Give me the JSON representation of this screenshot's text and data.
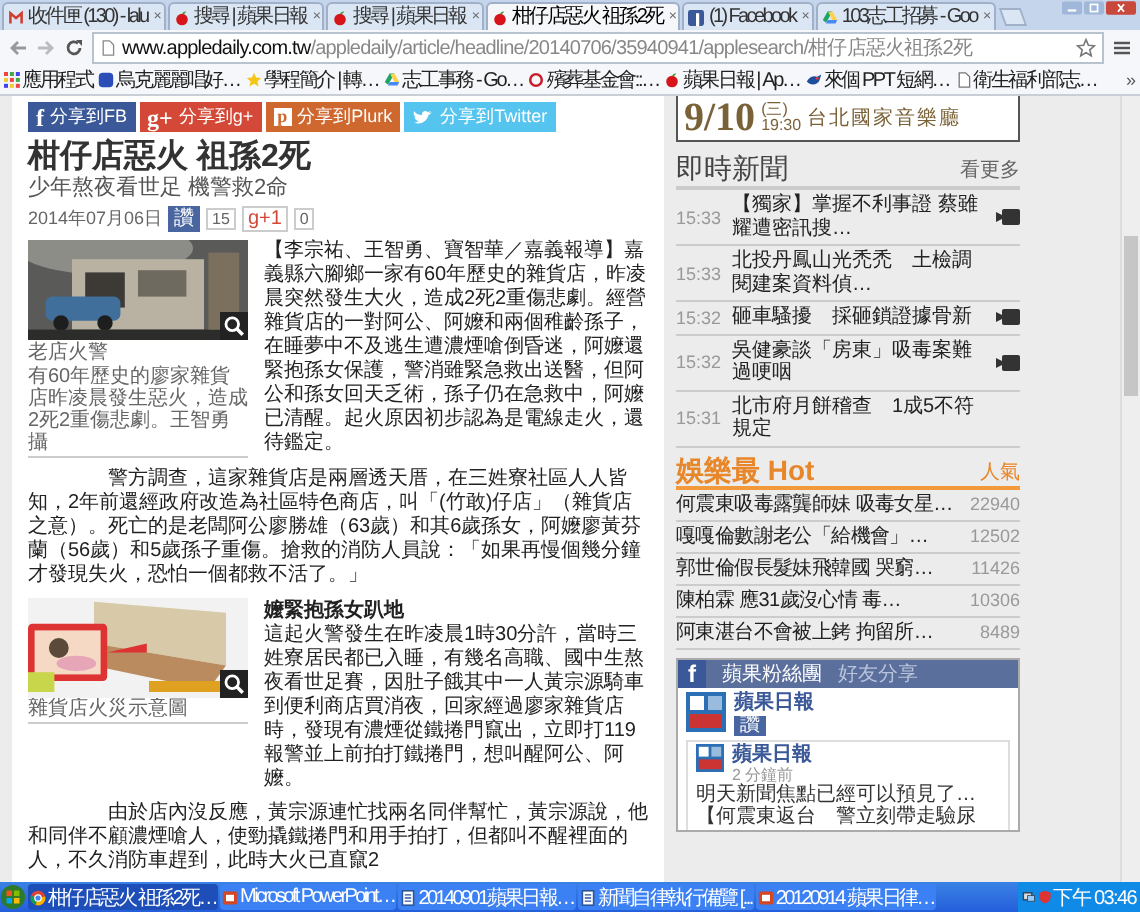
{
  "browser": {
    "tabs": [
      {
        "title": "收件匣 (130) - lalu",
        "close": "×",
        "selected": false
      },
      {
        "title": "搜尋 | 蘋果日報",
        "close": "×",
        "selected": false
      },
      {
        "title": "搜尋 | 蘋果日報",
        "close": "×",
        "selected": false
      },
      {
        "title": "柑仔店惡火 祖孫2死",
        "close": "×",
        "selected": true
      },
      {
        "title": "(1) Facebook",
        "close": "×",
        "selected": false
      },
      {
        "title": "103志工招募 - Goo",
        "close": "×",
        "selected": false
      }
    ],
    "url_host": "www.appledaily.com.tw",
    "url_path": "/appledaily/article/headline/20140706/35940941/applesearch/柑仔店惡火祖孫2死",
    "bookmarks": [
      "應用程式",
      "烏克麗麗唱好…",
      "學程簡介 | 轉…",
      "志工事務 - Go…",
      "殯葬基金會::…",
      "蘋果日報 | Ap…",
      "來個 PPT 短網…",
      "衛生福利部志…"
    ],
    "bookmarks_more": "»"
  },
  "article": {
    "share_buttons": [
      {
        "glyph": "f",
        "label": "分享到FB"
      },
      {
        "glyph": "g+",
        "label": "分享到g+"
      },
      {
        "glyph": "p",
        "label": "分享到Plurk"
      },
      {
        "label": "分享到Twitter"
      }
    ],
    "title": "柑仔店惡火 祖孫2死",
    "subtitle": "少年熬夜看世足 機警救2命",
    "date": "2014年07月06日",
    "like_buttons": [
      {
        "label": "讚",
        "count": "15"
      },
      {
        "label": "g+1",
        "count": "0"
      }
    ],
    "sections": [
      {
        "figure": {
          "title": "老店火警",
          "caption": "有60年歷史的廖家雜貨店昨凌晨發生惡火，造成2死2重傷悲劇。王智勇攝"
        },
        "side": [
          {
            "kind": "paragraph",
            "indent": false,
            "text": "【李宗祐、王智勇、寶智華／嘉義報導】嘉義縣六腳鄉一家有60年歷史的雜貨店，昨凌晨突然發生大火，造成2死2重傷悲劇。經營雜貨店的一對阿公、阿嬤和兩個稚齡孫子，在睡夢中不及逃生遭濃煙嗆倒昏迷，阿嬤還緊抱孫女保護，警消雖緊急救出送醫，但阿公和孫女回天乏術，孫子仍在急救中，阿嬤已清醒。起火原因初步認為是電線走火，還待鑑定。"
          }
        ],
        "below": [
          {
            "indent": true,
            "text": "警方調查，這家雜貨店是兩層透天厝，在三姓寮社區人人皆知，2年前還經政府改造為社區特色商店，叫「(竹敢)仔店」（雜貨店之意）。死亡的是老闆阿公廖勝雄（63歲）和其6歲孫女，阿嬤廖黃芬蘭（56歲）和5歲孫子重傷。搶救的消防人員說：「如果再慢個幾分鐘才發現失火，恐怕一個都救不活了。」"
          }
        ]
      },
      {
        "figure": {
          "caption": "雜貨店火災示意圖"
        },
        "side": [
          {
            "kind": "heading",
            "text": "嬤緊抱孫女趴地"
          },
          {
            "kind": "paragraph",
            "indent": false,
            "text": "這起火警發生在昨凌晨1時30分許，當時三姓寮居民都已入睡，有幾名高職、國中生熬夜看世足賽，因肚子餓其中一人黃宗源騎車到便利商店買消夜，回家經過廖家雜貨店時，發現有濃煙從鐵捲門竄出，立即打119報警並上前拍打鐵捲門，想叫醒阿公、阿嬤。"
          }
        ],
        "below": [
          {
            "indent": true,
            "text": "由於店內沒反應，黃宗源連忙找兩名同伴幫忙，黃宗源說，他和同伴不顧濃煙嗆人，使勁撬鐵捲門和用手拍打，但都叫不醒裡面的人，不久消防車趕到，此時大火已直竄2"
          }
        ]
      }
    ]
  },
  "sidebar": {
    "ad": {
      "date": "9/10",
      "weekday": "(三)",
      "time": "19:30",
      "venue": "台北國家音樂廳"
    },
    "live_news": {
      "title": "即時新聞",
      "more": "看更多",
      "items": [
        {
          "time": "15:33",
          "title": "【獨家】掌握不利事證 蔡雖耀遭密訊搜…",
          "video": true
        },
        {
          "time": "15:33",
          "title": "北投丹鳳山光禿禿　土檢調閱建案資料偵…",
          "video": false
        },
        {
          "time": "15:32",
          "title": "砸車騷擾　採砸鎖證據骨新",
          "video": true
        },
        {
          "time": "15:32",
          "title": "吳健豪談「房東」吸毒案難過哽咽",
          "video": true
        },
        {
          "time": "15:31",
          "title": "北市府月餅稽查　1成5不符規定",
          "video": false
        }
      ]
    },
    "hot": {
      "title": "娛樂最 Hot",
      "metric": "人氣",
      "items": [
        {
          "title": "何震東吸毒露龔師妹 吸毒女星…",
          "count": "22940"
        },
        {
          "title": "嘎嘎倫數謝老公「給機會」…",
          "count": "12502"
        },
        {
          "title": "郭世倫假長髮妹飛韓國 哭窮…",
          "count": "11426"
        },
        {
          "title": "陳柏霖 應31歲沒心情 毒…",
          "count": "10306"
        },
        {
          "title": "阿東湛台不會被上銬 拘留所…",
          "count": "8489"
        }
      ]
    },
    "facebook_box": {
      "logo": "f",
      "tabs": [
        {
          "label": "蘋果粉絲團",
          "selected": true
        },
        {
          "label": "好友分享",
          "selected": false
        }
      ],
      "page_name": "蘋果日報",
      "like": "讚",
      "post": {
        "author": "蘋果日報",
        "time": "2 分鐘前",
        "lines": [
          "明天新聞焦點已經可以預見了…",
          "【何震東返台　警立刻帶走驗尿"
        ]
      }
    }
  },
  "taskbar": {
    "items": [
      {
        "label": "柑仔店惡火 祖孫2死…",
        "selected": true
      },
      {
        "label": "Microsoft PowerPoint…",
        "selected": false
      },
      {
        "label": "20140901蘋果日報…",
        "selected": false
      },
      {
        "label": "新聞自律執行備覽 [...",
        "selected": false
      },
      {
        "label": "20120914 蘋果日律…",
        "selected": false
      }
    ],
    "clock": "下午 03:46"
  }
}
